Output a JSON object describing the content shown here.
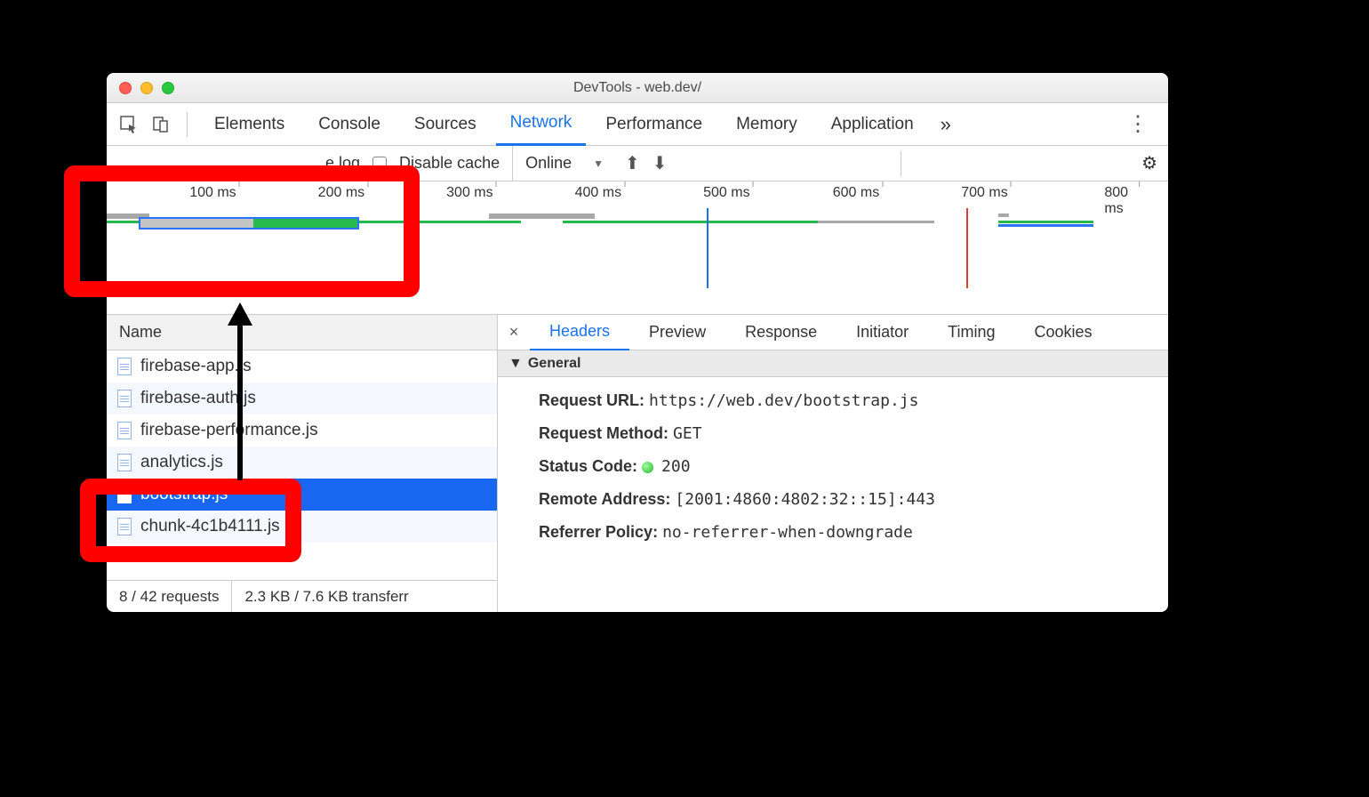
{
  "window": {
    "title": "DevTools - web.dev/"
  },
  "tabs": {
    "items": [
      "Elements",
      "Console",
      "Sources",
      "Network",
      "Performance",
      "Memory",
      "Application"
    ],
    "active": "Network",
    "overflow": "»"
  },
  "toolbar": {
    "preserve_log": "e log",
    "disable_cache": "Disable cache",
    "throttle": "Online"
  },
  "timeline": {
    "ticks": [
      "100 ms",
      "200 ms",
      "300 ms",
      "400 ms",
      "500 ms",
      "600 ms",
      "700 ms",
      "800 ms"
    ]
  },
  "left": {
    "header": "Name",
    "files": [
      "firebase-app.js",
      "firebase-auth.js",
      "firebase-performance.js",
      "analytics.js",
      "bootstrap.js",
      "chunk-4c1b4111.js"
    ],
    "selected_index": 4,
    "status": {
      "requests": "8 / 42 requests",
      "transfer": "2.3 KB / 7.6 KB transferr"
    }
  },
  "detail": {
    "tabs": [
      "Headers",
      "Preview",
      "Response",
      "Initiator",
      "Timing",
      "Cookies"
    ],
    "active": "Headers",
    "section": "General",
    "general": {
      "request_url_label": "Request URL:",
      "request_url": "https://web.dev/bootstrap.js",
      "request_method_label": "Request Method:",
      "request_method": "GET",
      "status_code_label": "Status Code:",
      "status_code": "200",
      "remote_address_label": "Remote Address:",
      "remote_address": "[2001:4860:4802:32::15]:443",
      "referrer_policy_label": "Referrer Policy:",
      "referrer_policy": "no-referrer-when-downgrade"
    }
  }
}
